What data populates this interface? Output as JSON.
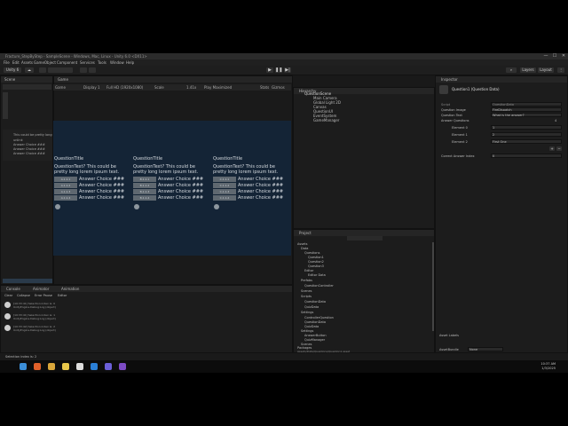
{
  "window": {
    "title": "Fracture_StepByStep - SampleScene - Windows, Mac, Linux - Unity 6.0 <DX11>",
    "controls": [
      "—",
      "☐",
      "✕"
    ]
  },
  "menu": [
    "File",
    "Edit",
    "Assets",
    "GameObject",
    "Component",
    "Services",
    "Tools",
    "Window",
    "Help"
  ],
  "toolbar": {
    "account": "Unity 6",
    "cloud": "☁",
    "search": "Search",
    "layers": "Layers",
    "layout": "Layout"
  },
  "left_panel": {
    "tab": "Scene",
    "text_lines": [
      "This could be pretty long",
      "unlink",
      "Answer Choice ###",
      "Answer Choice ###",
      "Answer Choice ###"
    ]
  },
  "game_view": {
    "tab": "Game",
    "bar": [
      "Game",
      "Display 1",
      "Full HD (1920x1080)",
      "Scale",
      "1.41x",
      "Play Maximized",
      "Stats",
      "Gizmos"
    ],
    "questions": [
      {
        "title": "QuestionTitle",
        "text": "QuestionText? This could be pretty long lorem ipsum text.",
        "answers": [
          {
            "box": "A.1.1.1",
            "label": "Answer Choice ###"
          },
          {
            "box": "A.1.1.2",
            "label": "Answer Choice ###"
          },
          {
            "box": "A.1.1.3",
            "label": "Answer Choice ###"
          },
          {
            "box": "A.1.1.4",
            "label": "Answer Choice ###"
          }
        ]
      },
      {
        "title": "QuestionTitle",
        "text": "QuestionText? This could be pretty long lorem ipsum text.",
        "answers": [
          {
            "box": "B.1.1.1",
            "label": "Answer Choice ###"
          },
          {
            "box": "B.1.1.2",
            "label": "Answer Choice ###"
          },
          {
            "box": "B.1.1.3",
            "label": "Answer Choice ###"
          },
          {
            "box": "B.1.1.4",
            "label": "Answer Choice ###"
          }
        ]
      },
      {
        "title": "QuestionTitle",
        "text": "QuestionText? This could be pretty long lorem ipsum text.",
        "answers": [
          {
            "box": "C.1.1.1",
            "label": "Answer Choice ###"
          },
          {
            "box": "C.1.1.2",
            "label": "Answer Choice ###"
          },
          {
            "box": "C.1.1.3",
            "label": "Answer Choice ###"
          },
          {
            "box": "C.1.1.4",
            "label": "Answer Choice ###"
          }
        ]
      }
    ]
  },
  "hierarchy": {
    "tab": "Hierarchy",
    "items": [
      "QuestionScene",
      "Main Camera",
      "Global Light 2D",
      "Canvas",
      "QuestionUI",
      "EventSystem",
      "GameManager"
    ]
  },
  "console": {
    "tabs": [
      "Console",
      "Animator",
      "Animation"
    ],
    "toolbar": [
      "Clear",
      "Collapse",
      "Error Pause",
      "Editor"
    ],
    "messages": [
      {
        "line1": "[10:33:41] Selection index is: 0",
        "line2": "UnityEngine.Debug:Log (object)"
      },
      {
        "line1": "[10:33:41] Selection index is: 1",
        "line2": "UnityEngine.Debug:Log (object)"
      },
      {
        "line1": "[10:33:42] Selection index is: 2",
        "line2": "UnityEngine.Debug:Log (object)"
      }
    ]
  },
  "project": {
    "tab": "Project",
    "tree": [
      "Assets",
      "Data",
      "Questions",
      "Question1",
      "Question2",
      "Question3",
      "Editor",
      "Editor Data",
      "Prefabs",
      "QuestionController",
      "Scenes",
      "Scripts",
      "QuestionData",
      "QuizData",
      "Settings",
      "ControllerQuestion",
      "QuestionData",
      "QuizData",
      "Settings",
      "AnswerButton",
      "QuizManager",
      "Scenes",
      "Packages"
    ],
    "path": "Assets/Data/Questions/Question1.asset"
  },
  "inspector": {
    "tab": "Inspector",
    "header": "Question1 (Question Data)",
    "script_label": "Script",
    "script_value": "QuestionData",
    "rows": [
      {
        "label": "Question Image",
        "value": "FireDispatch"
      },
      {
        "label": "Question Text",
        "value": "What is the answer?"
      },
      {
        "label": "Answer Questions",
        "value": "4"
      },
      {
        "label": "Element 0",
        "value": "1"
      },
      {
        "label": "Element 1",
        "value": "2"
      },
      {
        "label": "Element 2",
        "value": "First One"
      }
    ],
    "correct_label": "Correct Answer Index",
    "correct_value": "0",
    "asset_labels": "Asset Labels",
    "asset_bundle": "AssetBundle",
    "none": "None"
  },
  "status": {
    "text": "Selection index is: 2"
  },
  "taskbar": {
    "time": "10:37 AM",
    "date": "1/3/2025",
    "icons": [
      "windows-icon",
      "search-icon",
      "firefox-icon",
      "chrome-icon",
      "explorer-icon",
      "unity-icon",
      "vscode-icon",
      "github-icon",
      "vs-icon"
    ]
  }
}
